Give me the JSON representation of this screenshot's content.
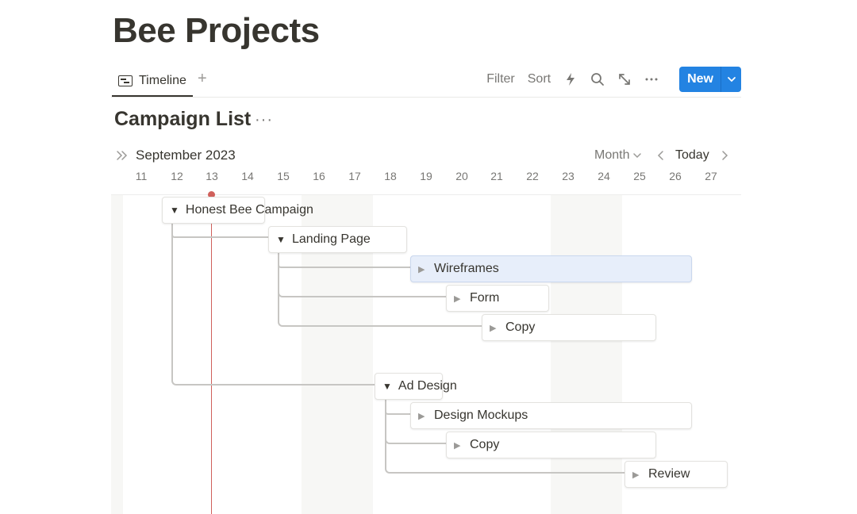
{
  "page": {
    "title": "Bee Projects"
  },
  "views": {
    "active_tab": "Timeline",
    "add_symbol": "+"
  },
  "toolbar": {
    "filter": "Filter",
    "sort": "Sort",
    "new_label": "New"
  },
  "database": {
    "title": "Campaign List",
    "more_symbol": "···"
  },
  "timeline": {
    "month_label": "September 2023",
    "scale": "Month",
    "today_label": "Today",
    "days": [
      "11",
      "12",
      "13",
      "14",
      "15",
      "16",
      "17",
      "18",
      "19",
      "20",
      "21",
      "22",
      "23",
      "24",
      "25",
      "26",
      "27"
    ],
    "current_day": "13"
  },
  "items": [
    {
      "label": "Honest Bee Campaign",
      "expanded": true
    },
    {
      "label": "Landing Page",
      "expanded": true
    },
    {
      "label": "Wireframes",
      "expanded": false,
      "selected": true
    },
    {
      "label": "Form",
      "expanded": false
    },
    {
      "label": "Copy",
      "expanded": false
    },
    {
      "label": "Ad Design",
      "expanded": true
    },
    {
      "label": "Design Mockups",
      "expanded": false
    },
    {
      "label": "Copy",
      "expanded": false
    },
    {
      "label": "Review",
      "expanded": false
    }
  ],
  "colors": {
    "accent": "#2383e2",
    "today_marker": "#d0605b",
    "selected_bg": "#e7eefa"
  }
}
